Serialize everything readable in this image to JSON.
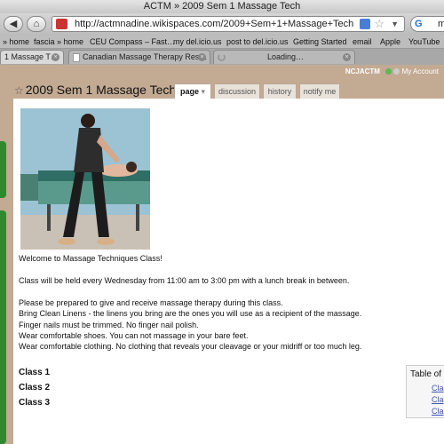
{
  "window": {
    "title": "ACTM » 2009 Sem 1 Massage Tech"
  },
  "nav": {
    "back_icon": "back-arrow-icon",
    "home_icon": "home-icon",
    "url": "http://actmnadine.wikispaces.com/2009+Sem+1+Massage+Tech",
    "search_value": "m"
  },
  "bookmarks": [
    "» home",
    "fascia » home",
    "CEU Compass – Fast…",
    "my del.icio.us",
    "post to del.icio.us",
    "Getting Started",
    "email",
    "Apple",
    "YouTube"
  ],
  "tabs": [
    {
      "label": "1 Massage T…"
    },
    {
      "label": "Canadian Massage Therapy Res…"
    },
    {
      "label": "Loading…"
    }
  ],
  "wiki": {
    "user": "NCJACTM",
    "account_link": "My Account",
    "page_title": "2009 Sem 1 Massage Tech",
    "tabs": [
      "page",
      "discussion",
      "history",
      "notify me"
    ],
    "dropdown_glyph": "▾"
  },
  "content": {
    "welcome": "Welcome to Massage Techniques Class!",
    "schedule": "Class will be held every Wednesday from 11:00 am to 3:00 pm with a lunch break in between.",
    "lines": [
      "Please be prepared to give and receive massage therapy during this class.",
      "Bring Clean Linens - the linens you bring are the ones you will use as a recipient of the massage.",
      "Finger nails must be trimmed. No finger nail polish.",
      "Wear comfortable shoes. You can not massage in your bare feet.",
      "Wear comfortable clothing. No clothing that reveals your cleavage or your midriff or too much leg."
    ],
    "headings": [
      "Class 1",
      "Class 2",
      "Class 3"
    ]
  },
  "toc": {
    "title": "Table of",
    "items": [
      "Cla",
      "Cla",
      "Cla"
    ]
  },
  "colors": {
    "page_bg": "#c3aa93",
    "green_accent": "#2f8a2f",
    "link": "#3a57b0"
  }
}
